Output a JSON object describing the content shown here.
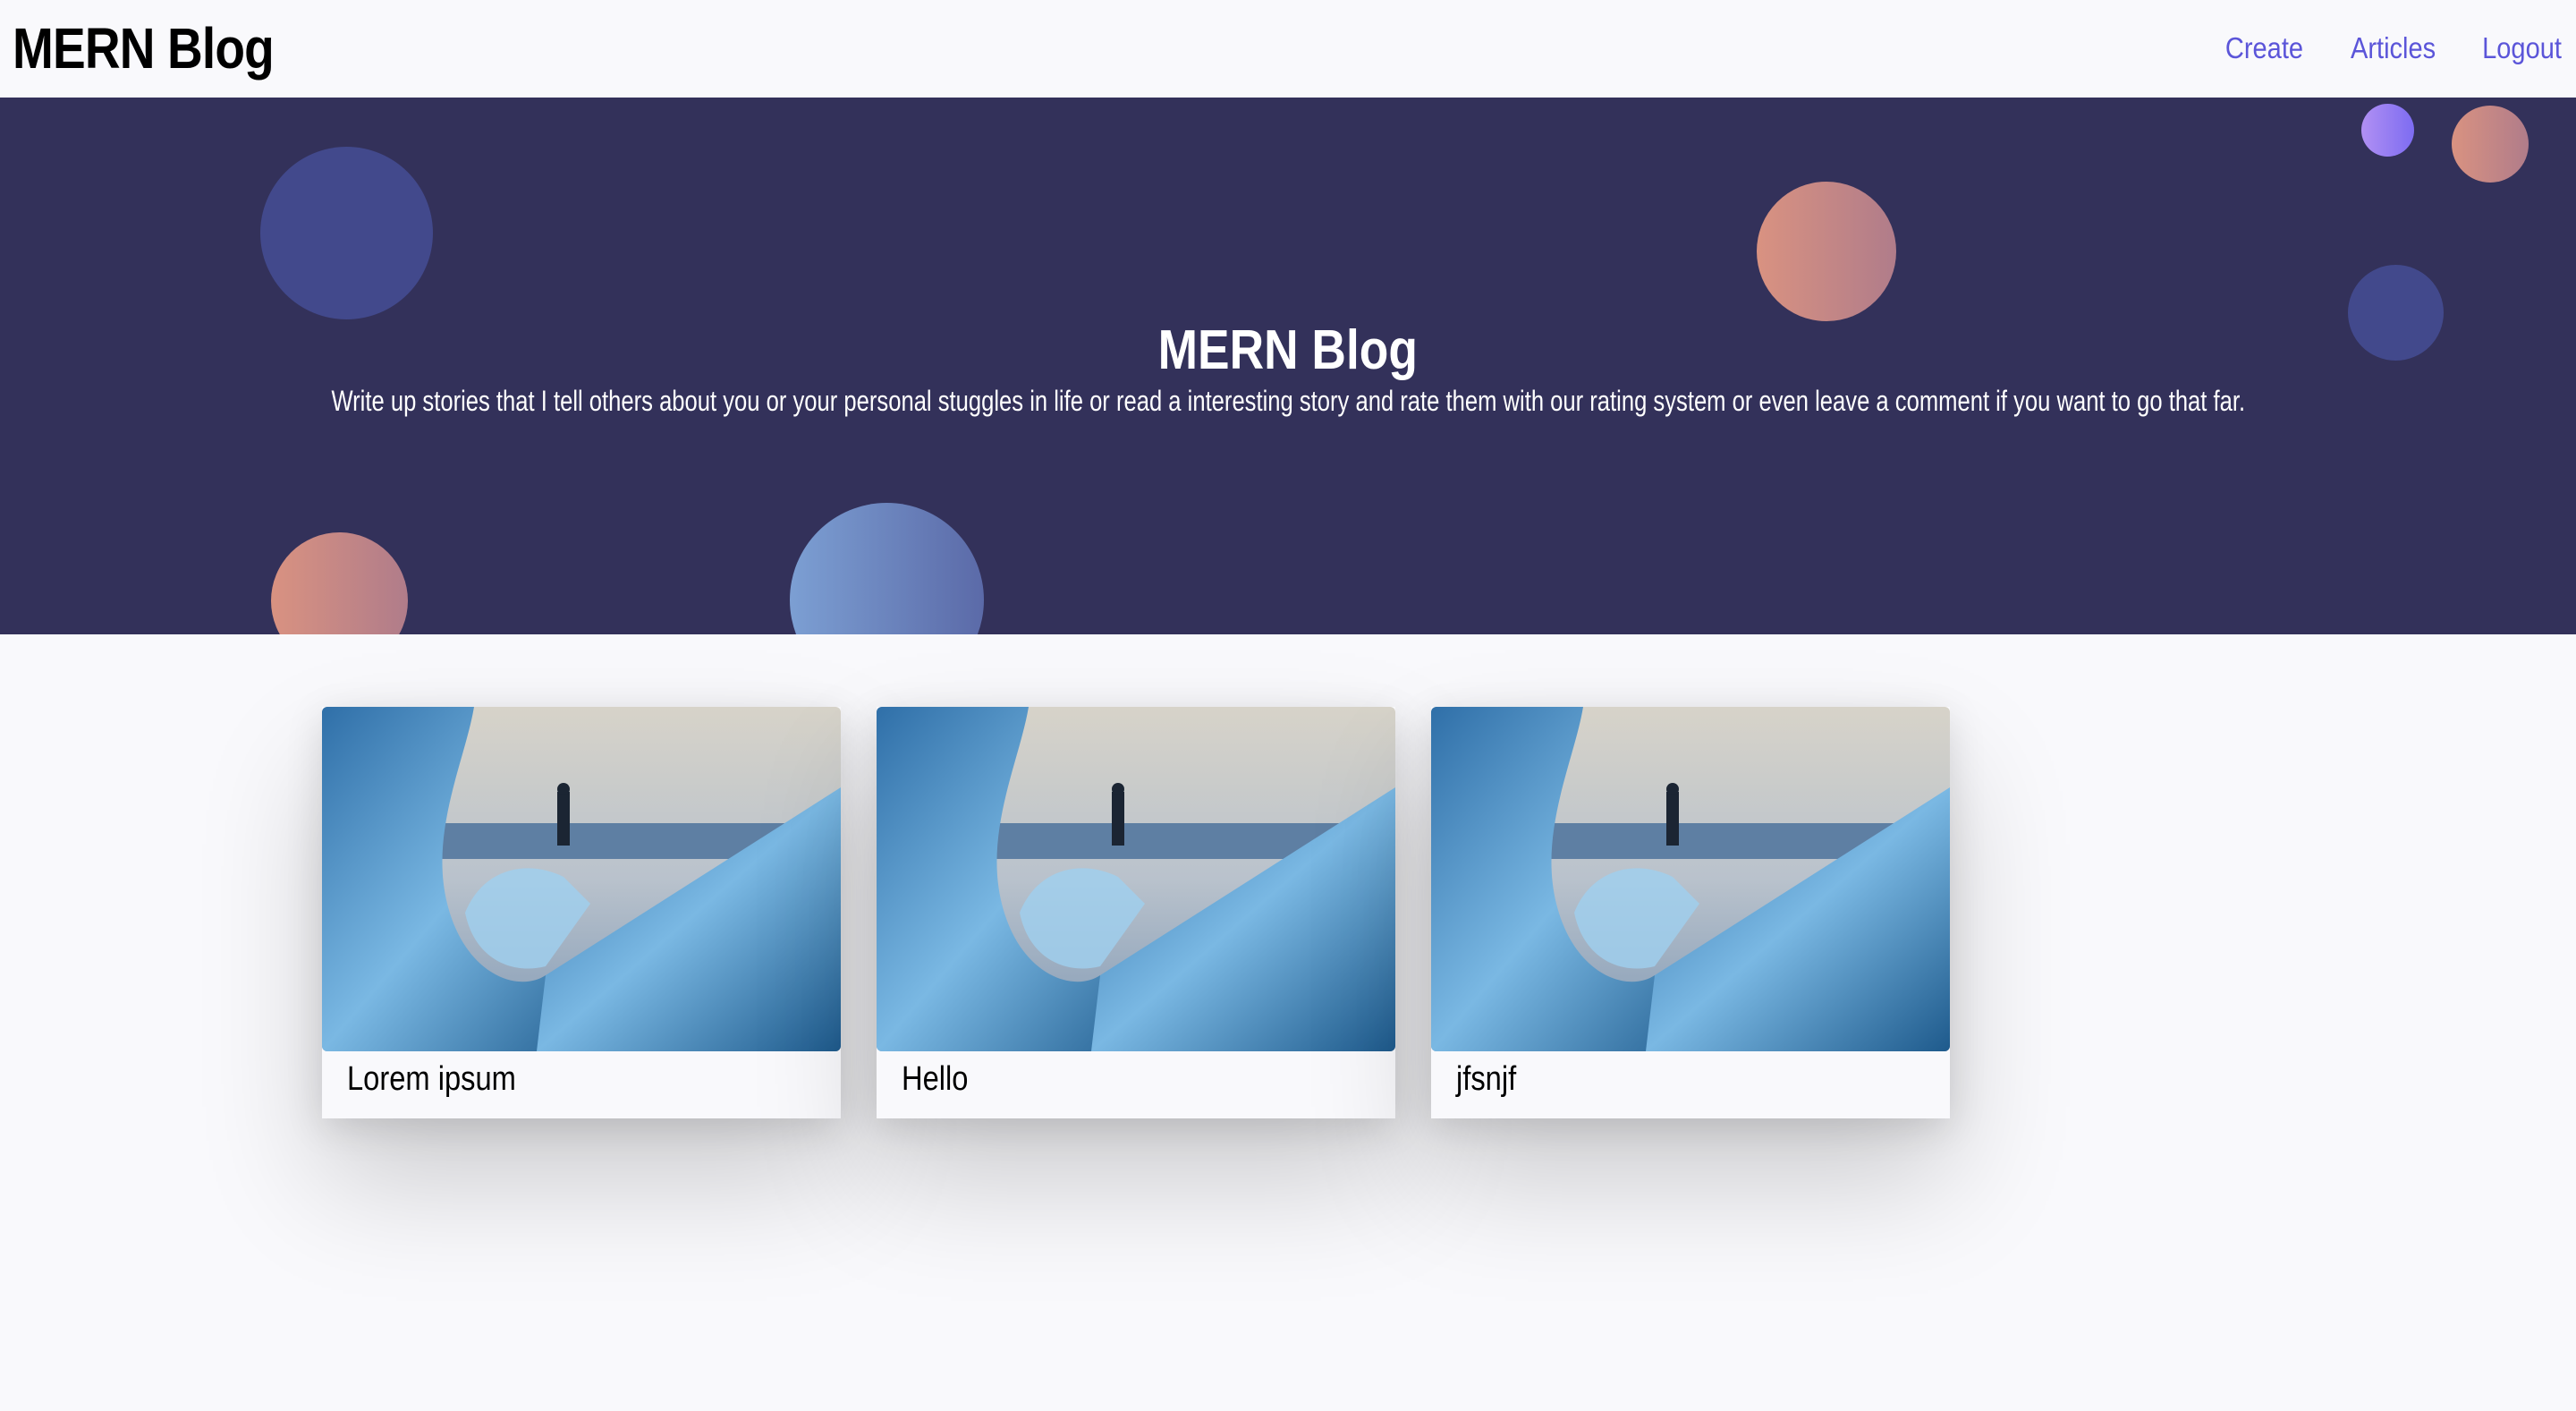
{
  "navbar": {
    "brand": "MERN Blog",
    "links": [
      "Create",
      "Articles",
      "Logout"
    ]
  },
  "hero": {
    "title": "MERN Blog",
    "subtitle": "Write up stories that I tell others about you or your personal stuggles in life or read a interesting story and rate them with our rating system or even leave a comment if you want to go that far."
  },
  "articles": [
    {
      "title": "Lorem ipsum"
    },
    {
      "title": "Hello"
    },
    {
      "title": "jfsnjf"
    }
  ],
  "colors": {
    "navbar_bg": "#f9f9fc",
    "nav_link": "#5b55d9",
    "hero_bg": "#33315a",
    "bubble_blue": "#42498c",
    "bubble_peach": "#d99281",
    "bubble_lilac": "#b190f3",
    "bubble_steel": "#7c9fd3"
  }
}
